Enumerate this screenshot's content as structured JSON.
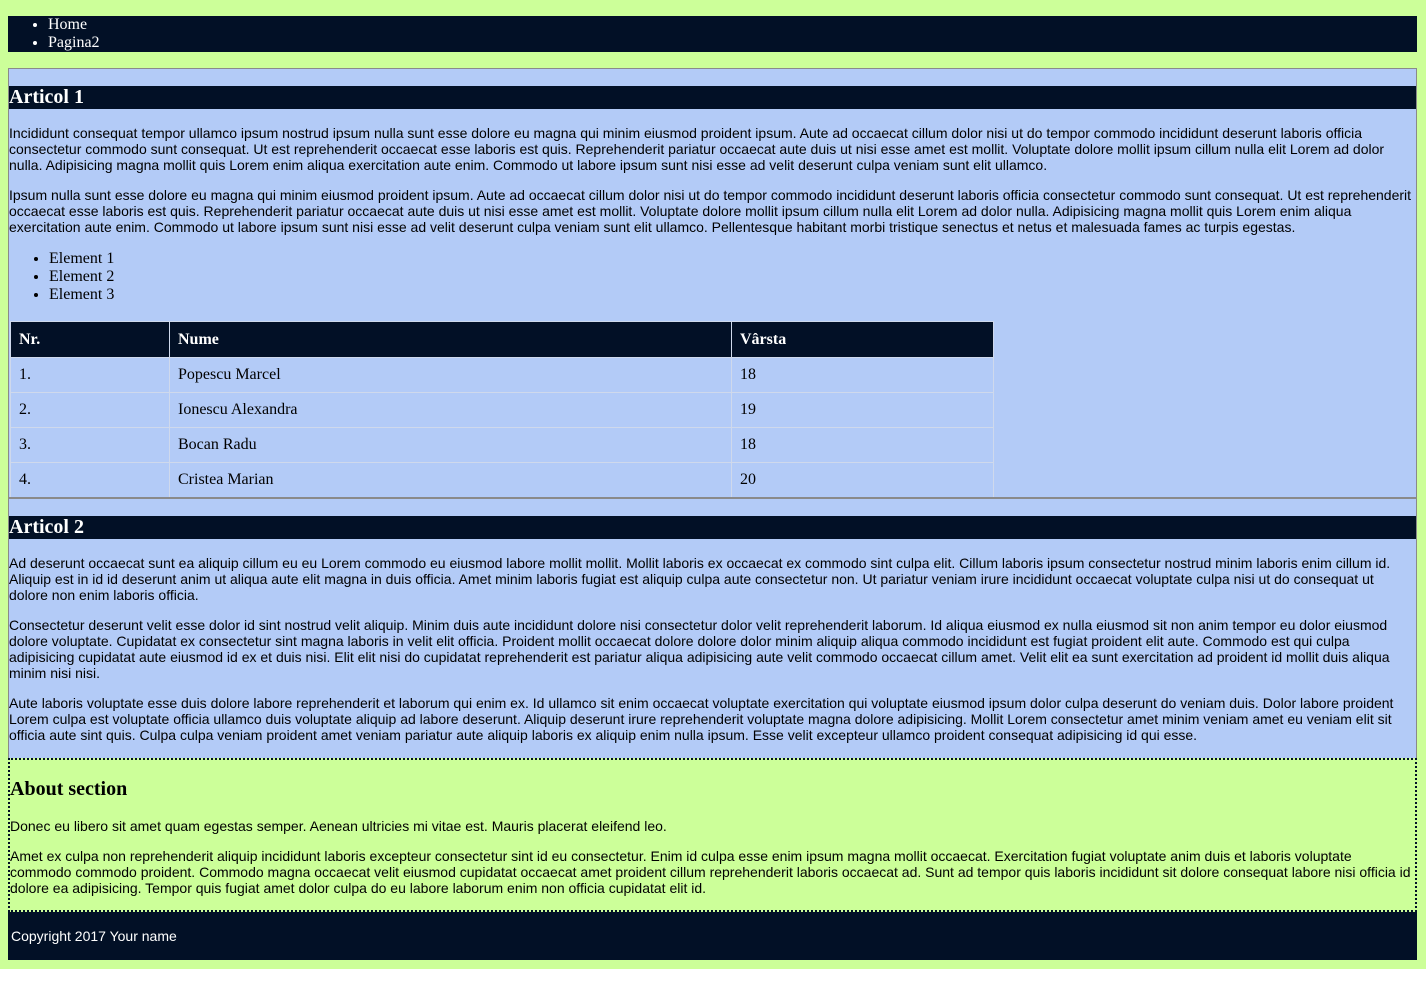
{
  "nav": {
    "items": [
      {
        "label": "Home"
      },
      {
        "label": "Pagina2"
      }
    ]
  },
  "article1": {
    "title": "Articol 1",
    "paragraphs": [
      "Incididunt consequat tempor ullamco ipsum nostrud ipsum nulla sunt esse dolore eu magna qui minim eiusmod proident ipsum. Aute ad occaecat cillum dolor nisi ut do tempor commodo incididunt deserunt laboris officia consectetur commodo sunt consequat. Ut est reprehenderit occaecat esse laboris est quis. Reprehenderit pariatur occaecat aute duis ut nisi esse amet est mollit. Voluptate dolore mollit ipsum cillum nulla elit Lorem ad dolor nulla. Adipisicing magna mollit quis Lorem enim aliqua exercitation aute enim. Commodo ut labore ipsum sunt nisi esse ad velit deserunt culpa veniam sunt elit ullamco.",
      "Ipsum nulla sunt esse dolore eu magna qui minim eiusmod proident ipsum. Aute ad occaecat cillum dolor nisi ut do tempor commodo incididunt deserunt laboris officia consectetur commodo sunt consequat. Ut est reprehenderit occaecat esse laboris est quis. Reprehenderit pariatur occaecat aute duis ut nisi esse amet est mollit. Voluptate dolore mollit ipsum cillum nulla elit Lorem ad dolor nulla. Adipisicing magna mollit quis Lorem enim aliqua exercitation aute enim. Commodo ut labore ipsum sunt nisi esse ad velit deserunt culpa veniam sunt elit ullamco. Pellentesque habitant morbi tristique senectus et netus et malesuada fames ac turpis egestas."
    ],
    "list": [
      "Element 1",
      "Element 2",
      "Element 3"
    ],
    "table": {
      "headers": [
        "Nr.",
        "Nume",
        "Vârsta"
      ],
      "rows": [
        [
          "1.",
          "Popescu Marcel",
          "18"
        ],
        [
          "2.",
          "Ionescu Alexandra",
          "19"
        ],
        [
          "3.",
          "Bocan Radu",
          "18"
        ],
        [
          "4.",
          "Cristea Marian",
          "20"
        ]
      ]
    }
  },
  "article2": {
    "title": "Articol 2",
    "paragraphs": [
      "Ad deserunt occaecat sunt ea aliquip cillum eu eu Lorem commodo eu eiusmod labore mollit mollit. Mollit laboris ex occaecat ex commodo sint culpa elit. Cillum laboris ipsum consectetur nostrud minim laboris enim cillum id. Aliquip est in id id deserunt anim ut aliqua aute elit magna in duis officia. Amet minim laboris fugiat est aliquip culpa aute consectetur non. Ut pariatur veniam irure incididunt occaecat voluptate culpa nisi ut do consequat ut dolore non enim laboris officia.",
      "Consectetur deserunt velit esse dolor id sint nostrud velit aliquip. Minim duis aute incididunt dolore nisi consectetur dolor velit reprehenderit laborum. Id aliqua eiusmod ex nulla eiusmod sit non anim tempor eu dolor eiusmod dolore voluptate. Cupidatat ex consectetur sint magna laboris in velit elit officia. Proident mollit occaecat dolore dolore dolor minim aliquip aliqua commodo incididunt est fugiat proident elit aute. Commodo est qui culpa adipisicing cupidatat aute eiusmod id ex et duis nisi. Elit elit nisi do cupidatat reprehenderit est pariatur aliqua adipisicing aute velit commodo occaecat cillum amet. Velit elit ea sunt exercitation ad proident id mollit duis aliqua minim nisi nisi.",
      "Aute laboris voluptate esse duis dolore labore reprehenderit et laborum qui enim ex. Id ullamco sit enim occaecat voluptate exercitation qui voluptate eiusmod ipsum dolor culpa deserunt do veniam duis. Dolor labore proident Lorem culpa est voluptate officia ullamco duis voluptate aliquip ad labore deserunt. Aliquip deserunt irure reprehenderit voluptate magna dolore adipisicing. Mollit Lorem consectetur amet minim veniam amet eu veniam elit sit officia aute sint quis. Culpa culpa veniam proident amet veniam pariatur aute aliquip laboris ex aliquip enim nulla ipsum. Esse velit excepteur ullamco proident consequat adipisicing id qui esse."
    ]
  },
  "about": {
    "title": "About section",
    "paragraphs": [
      "Donec eu libero sit amet quam egestas semper. Aenean ultricies mi vitae est. Mauris placerat eleifend leo.",
      "Amet ex culpa non reprehenderit aliquip incididunt laboris excepteur consectetur sint id eu consectetur. Enim id culpa esse enim ipsum magna mollit occaecat. Exercitation fugiat voluptate anim duis et laboris voluptate commodo commodo proident. Commodo magna occaecat velit eiusmod cupidatat occaecat amet proident cillum reprehenderit laboris occaecat ad. Sunt ad tempor quis laboris incididunt sit dolore consequat labore nisi officia id dolore ea adipisicing. Tempor quis fugiat amet dolor culpa do eu labore laborum enim non officia cupidatat elit id."
    ]
  },
  "footer": {
    "copyright": "Copyright 2017 Your name"
  },
  "colors": {
    "page_background": "#ccff99",
    "dark_bar": "#021026",
    "main_background": "#b3cbf7"
  }
}
